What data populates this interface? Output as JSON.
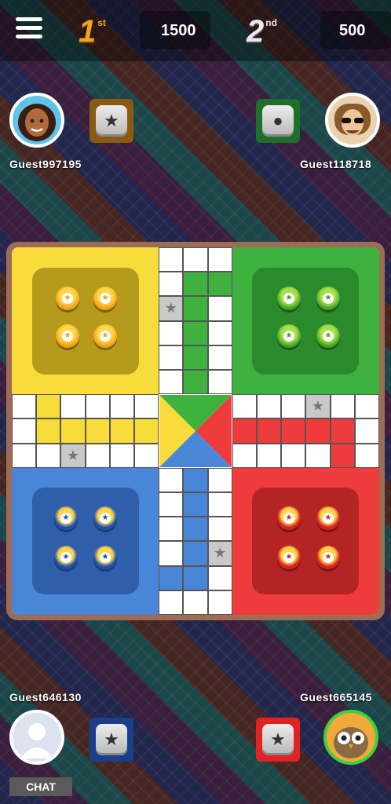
{
  "topbar": {
    "first_rank": "1",
    "first_suffix": "st",
    "first_score": "1500",
    "second_rank": "2",
    "second_suffix": "nd",
    "second_score": "500"
  },
  "players": {
    "top_left": {
      "name": "Guest997195",
      "color": "#f39c12",
      "die": "★"
    },
    "top_right": {
      "name": "Guest118718",
      "color": "#3a9d23",
      "die": "●"
    },
    "bottom_left": {
      "name": "Guest646130",
      "color": "#1e4fb5",
      "die": "★"
    },
    "bottom_right": {
      "name": "Guest665145",
      "color": "#e02424",
      "die": "★"
    }
  },
  "chat": {
    "label": "CHAT"
  },
  "colors": {
    "yellow": "#f7dc3a",
    "green": "#3fb13f",
    "blue": "#4a86d8",
    "red": "#ee3b3b"
  }
}
